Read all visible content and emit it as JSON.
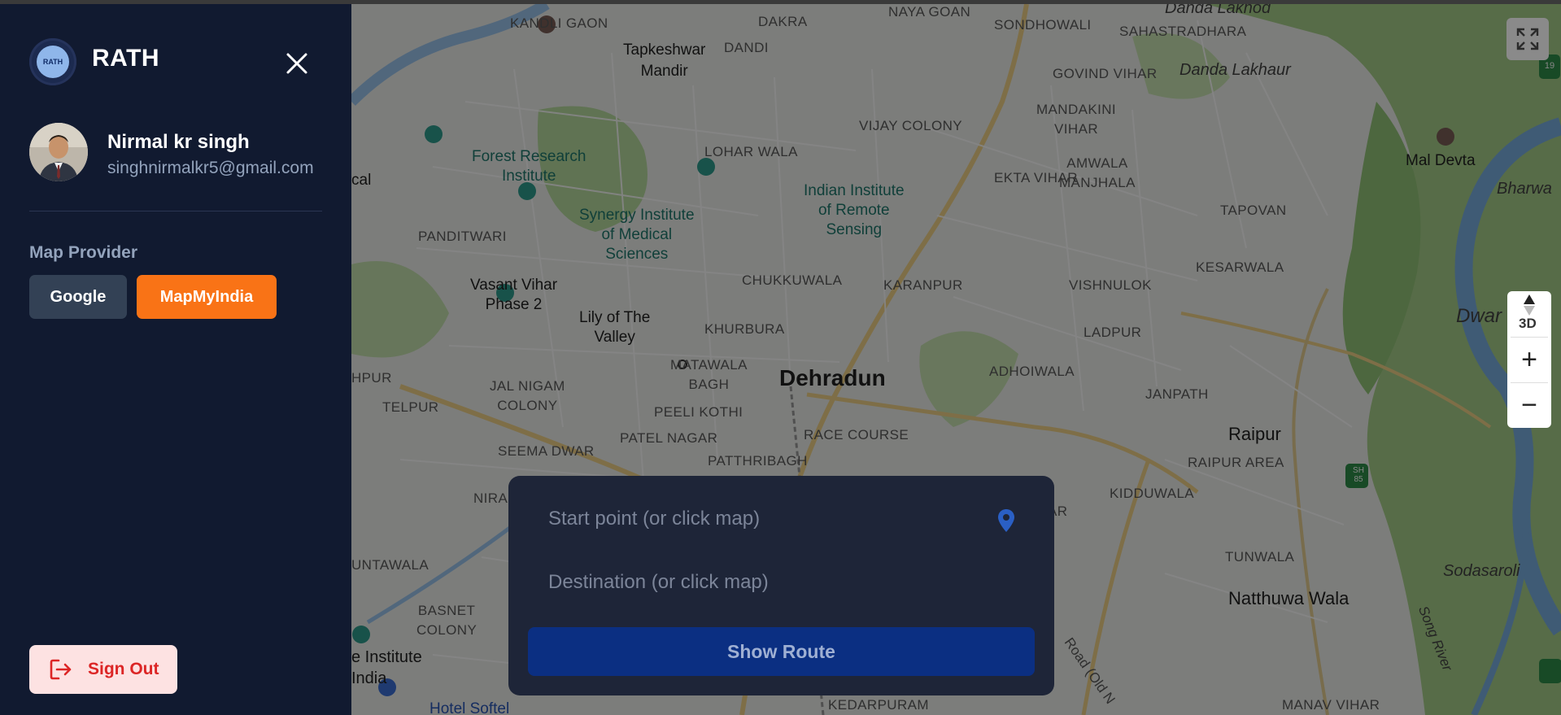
{
  "app": {
    "title": "RATH",
    "logo_text": "RATH"
  },
  "user": {
    "name": "Nirmal kr singh",
    "email": "singhnirmalkr5@gmail.com"
  },
  "map_provider": {
    "label": "Map Provider",
    "options": [
      "Google",
      "MapMyIndia"
    ],
    "selected": "MapMyIndia"
  },
  "sign_out": {
    "label": "Sign Out"
  },
  "route": {
    "start_placeholder": "Start point (or click map)",
    "destination_placeholder": "Destination (or click map)",
    "button_label": "Show Route"
  },
  "map_controls": {
    "mode_3d": "3D",
    "zoom_in": "+",
    "zoom_out": "−"
  },
  "map_labels": {
    "kandli_gaon": "KANDLI GAON",
    "dakra": "DAKRA",
    "naya_goan": "NAYA GOAN",
    "sondhowali": "SONDHOWALI",
    "danda_lakhod": "Danda Lakhod",
    "sahastradhara": "SAHASTRADHARA",
    "tapkeshwar": "Tapkeshwar\nMandir",
    "dandi": "DANDI",
    "govind_vihar": "GOVIND VIHAR",
    "danda_lakhaur": "Danda Lakhaur",
    "mandakini": "MANDAKINI\nVIHAR",
    "vijay_colony": "VIJAY COLONY",
    "forest_research": "Forest Research\nInstitute",
    "lohar_wala": "LOHAR WALA",
    "indian_institute": "Indian Institute\nof Remote\nSensing",
    "amwala": "AMWALA\nMANJHALA",
    "ekta_vihar": "EKTA VIHAR",
    "mal_devta": "Mal Devta",
    "bharwa": "Bharwa",
    "cal": "cal",
    "synergy": "Synergy Institute\nof Medical\nSciences",
    "panditwari": "PANDITWARI",
    "tapovan": "TAPOVAN",
    "vasant_vihar": "Vasant Vihar\nPhase 2",
    "chukkuwala": "CHUKKUWALA",
    "karanpur": "KARANPUR",
    "vishnulok": "VISHNULOK",
    "kesarwala": "KESARWALA",
    "dwara": "Dwar",
    "lily": "Lily of The\nValley",
    "khurbura": "KHURBURA",
    "ladpur": "LADPUR",
    "hpur": "HPUR",
    "jal_nigam": "JAL NIGAM\nCOLONY",
    "matawala": "MATAWALA\nBAGH",
    "dehradun": "Dehradun",
    "adhoiwala": "ADHOIWALA",
    "telpur": "TELPUR",
    "peeli_kothi": "PEELI KOTHI",
    "janpath": "JANPATH",
    "patel_nagar": "PATEL NAGAR",
    "race_course": "RACE COURSE",
    "raipur": "Raipur",
    "seema_dwar": "SEEMA DWAR",
    "patthribagh": "PATTHRIBAGH",
    "raipur_area": "RAIPUR AREA",
    "nira": "NIRA",
    "kidduwala": "KIDDUWALA",
    "ar": "AR",
    "untawala": "UNTAWALA",
    "tunwala": "TUNWALA",
    "sodasaroli": "Sodasaroli",
    "basnet": "BASNET\nCOLONY",
    "natthuwa": "Natthuwa Wala",
    "song_river": "Song River",
    "e_institute": "e Institute\nIndia",
    "hotel_softel": "Hotel Softel",
    "kedarpuram": "KEDARPURAM",
    "manav_vihar": "MANAV VIHAR",
    "road_old": "Road (Old N",
    "sh_85": "SH\n85",
    "nh_19": "19"
  },
  "colors": {
    "sidebar_bg": "#111a30",
    "accent_orange": "#f97316",
    "route_button": "#0b2f82",
    "signout_bg": "#fde2e2",
    "signout_text": "#dc2626"
  }
}
